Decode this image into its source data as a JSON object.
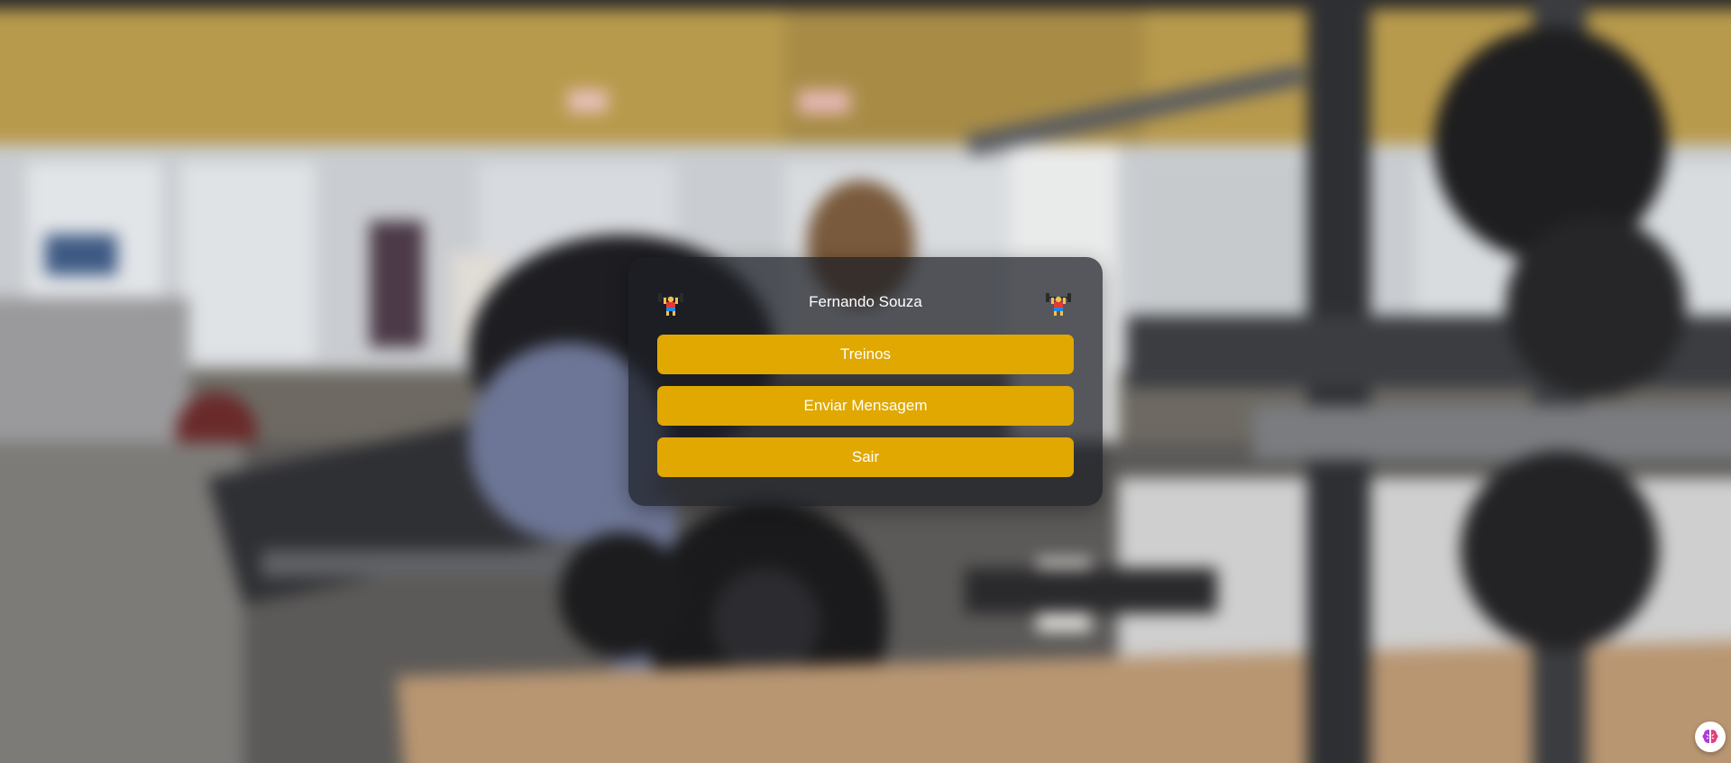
{
  "profile": {
    "name": "Fernando Souza",
    "left_icon": "weightlifter-icon",
    "right_icon": "weightlifter-icon"
  },
  "menu": {
    "items": [
      {
        "label": "Treinos"
      },
      {
        "label": "Enviar Mensagem"
      },
      {
        "label": "Sair"
      }
    ]
  },
  "floating_button": {
    "icon": "brain-icon"
  },
  "colors": {
    "button": "#e0a800",
    "button_text": "#ffffff",
    "panel": "#1c1e26",
    "title": "#ffffff",
    "floating_icon": "#b03ad8"
  }
}
